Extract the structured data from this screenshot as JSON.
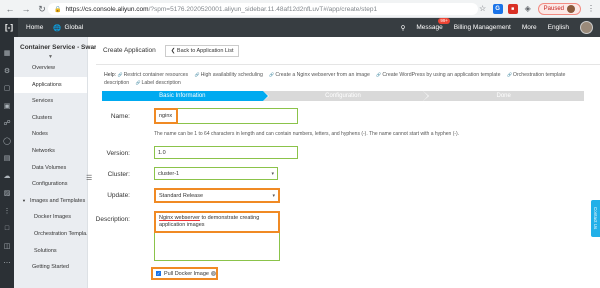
{
  "browser": {
    "url_host": "https://cs.console.aliyun.com",
    "url_path": "/?spm=5176.2020520001.aliyun_sidebar.11.48af12d2nfLuvT#/app/create/step1",
    "paused_label": "Paused"
  },
  "topbar": {
    "home": "Home",
    "global": "Global",
    "message": "Message",
    "message_badge": "99+",
    "billing": "Billing Management",
    "more": "More",
    "language": "English"
  },
  "sidebar": {
    "title": "Container Service - Swarm",
    "items": [
      {
        "label": "Overview",
        "kind": "item"
      },
      {
        "label": "Applications",
        "kind": "active"
      },
      {
        "label": "Services",
        "kind": "item"
      },
      {
        "label": "Clusters",
        "kind": "item"
      },
      {
        "label": "Nodes",
        "kind": "item"
      },
      {
        "label": "Networks",
        "kind": "item"
      },
      {
        "label": "Data Volumes",
        "kind": "item"
      },
      {
        "label": "Configurations",
        "kind": "item"
      },
      {
        "label": "Images and Templates",
        "kind": "group"
      },
      {
        "label": "Docker Images",
        "kind": "sub"
      },
      {
        "label": "Orchestration Templa...",
        "kind": "sub"
      },
      {
        "label": "Solutions",
        "kind": "sub"
      },
      {
        "label": "Getting Started",
        "kind": "item"
      }
    ]
  },
  "page": {
    "title": "Create Application",
    "back_button": "Back to Application List"
  },
  "help": {
    "label": "Help:",
    "links": [
      "Restrict container resources",
      "High availability scheduling",
      "Create a Nginx webserver from an image",
      "Create WordPress by using an application template",
      "Orchestration template description",
      "Label description"
    ]
  },
  "steps": [
    "Basic Information",
    "Configuration",
    "Done"
  ],
  "form": {
    "name_label": "Name:",
    "name_value": "nginx",
    "name_hint": "The name can be 1 to 64 characters in length and can contain numbers, letters, and hyphens (-). The name cannot start with a hyphen (-).",
    "version_label": "Version:",
    "version_value": "1.0",
    "cluster_label": "Cluster:",
    "cluster_value": "cluster-1",
    "update_label": "Update:",
    "update_value": "Standard Release",
    "description_label": "Description:",
    "description_value_1": "Nginx webserver",
    "description_value_2": " to demonstrate creating application images",
    "pull_label": "Pull Docker Image"
  },
  "contact_label": "Contact Us",
  "colors": {
    "step_active": "#00aaf0",
    "highlight": "#f08a24",
    "valid_border": "#8bc34a",
    "topbar": "#373d41"
  }
}
